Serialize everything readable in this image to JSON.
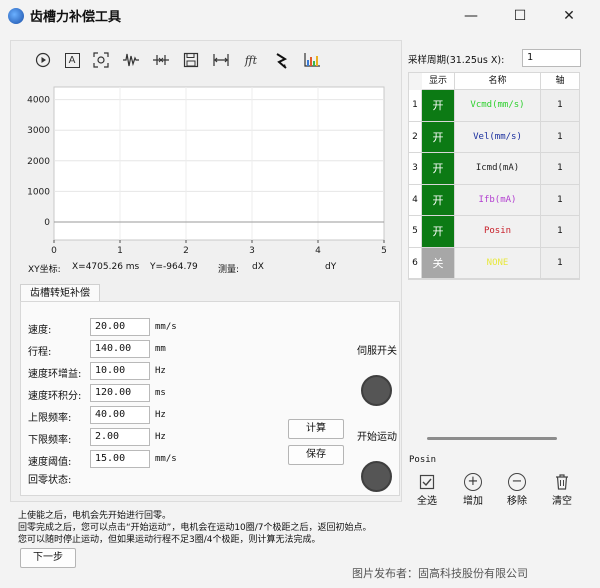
{
  "window": {
    "title": "齿槽力补偿工具",
    "minimize": "—",
    "maximize": "☐",
    "close": "✕"
  },
  "toolbar": {
    "icons": [
      "play-icon",
      "text-icon",
      "zoom-fit-icon",
      "waveform-icon",
      "cursor-icon",
      "save-icon",
      "measure-icon",
      "fft-icon",
      "arrow-icon",
      "chart-icon"
    ],
    "fft_label": "fft",
    "text_label": "A"
  },
  "chart_data": {
    "type": "line",
    "x": [
      0,
      1,
      2,
      3,
      4,
      5
    ],
    "xlim": [
      0,
      5
    ],
    "ylim": [
      0,
      5000
    ],
    "xticks": [
      "0",
      "1",
      "2",
      "3",
      "4",
      "5"
    ],
    "yticks": [
      "0",
      "1000",
      "2000",
      "3000",
      "4000",
      "5000"
    ],
    "series": [
      {
        "values": [
          0,
          0,
          0,
          0,
          0,
          0
        ],
        "color": "#999999"
      }
    ],
    "grid": true
  },
  "status": {
    "xy_label": "XY坐标:",
    "x_value": "X=4705.26 ms",
    "y_value": "Y=-964.79",
    "measure_label": "测量:",
    "dx": "dX",
    "dy": "dY"
  },
  "tab": {
    "label": "齿槽转矩补偿"
  },
  "form": {
    "fields": [
      {
        "label": "速度:",
        "value": "20.00",
        "unit": "mm/s"
      },
      {
        "label": "行程:",
        "value": "140.00",
        "unit": "mm"
      },
      {
        "label": "速度环增益:",
        "value": "10.00",
        "unit": "Hz"
      },
      {
        "label": "速度环积分:",
        "value": "120.00",
        "unit": "ms"
      },
      {
        "label": "上限频率:",
        "value": "40.00",
        "unit": "Hz"
      },
      {
        "label": "下限频率:",
        "value": "2.00",
        "unit": "Hz"
      },
      {
        "label": "速度阈值:",
        "value": "15.00",
        "unit": "mm/s"
      }
    ],
    "home_status_label": "回零状态:",
    "calc_button": "计算",
    "save_button": "保存",
    "servo_label": "伺服开关",
    "start_label": "开始运动"
  },
  "instructions": [
    "上使能之后，电机会先开始进行回零。",
    "回零完成之后，您可以点击“开始运动”，电机会在运动10圈/7个极距之后，返回初始点。",
    "您可以随时停止运动，但如果运动行程不足3圈/4个极距，则计算无法完成。"
  ],
  "next_button": "下一步",
  "sampling": {
    "label": "采样周期(31.25us X):",
    "value": "1"
  },
  "channel_table": {
    "headers": [
      "显示",
      "名称",
      "轴"
    ],
    "rows": [
      {
        "index": "1",
        "toggle": "开",
        "on": true,
        "name": "Vcmd(mm/s)",
        "color": "#2fd12f",
        "axis": "1"
      },
      {
        "index": "2",
        "toggle": "开",
        "on": true,
        "name": "Vel(mm/s)",
        "color": "#1a2f9e",
        "axis": "1"
      },
      {
        "index": "3",
        "toggle": "开",
        "on": true,
        "name": "Icmd(mA)",
        "color": "#222222",
        "axis": "1"
      },
      {
        "index": "4",
        "toggle": "开",
        "on": true,
        "name": "Ifb(mA)",
        "color": "#b23fd0",
        "axis": "1"
      },
      {
        "index": "5",
        "toggle": "开",
        "on": true,
        "name": "Posin",
        "color": "#c8202a",
        "axis": "1"
      },
      {
        "index": "6",
        "toggle": "关",
        "on": false,
        "name": "NONE",
        "color": "#e8e840",
        "axis": "1"
      }
    ]
  },
  "channel_panel": {
    "selected_name": "Posin",
    "select_all": "全选",
    "add": "增加",
    "remove": "移除",
    "clear": "清空"
  },
  "watermark": "图片发布者：固高科技股份有限公司"
}
